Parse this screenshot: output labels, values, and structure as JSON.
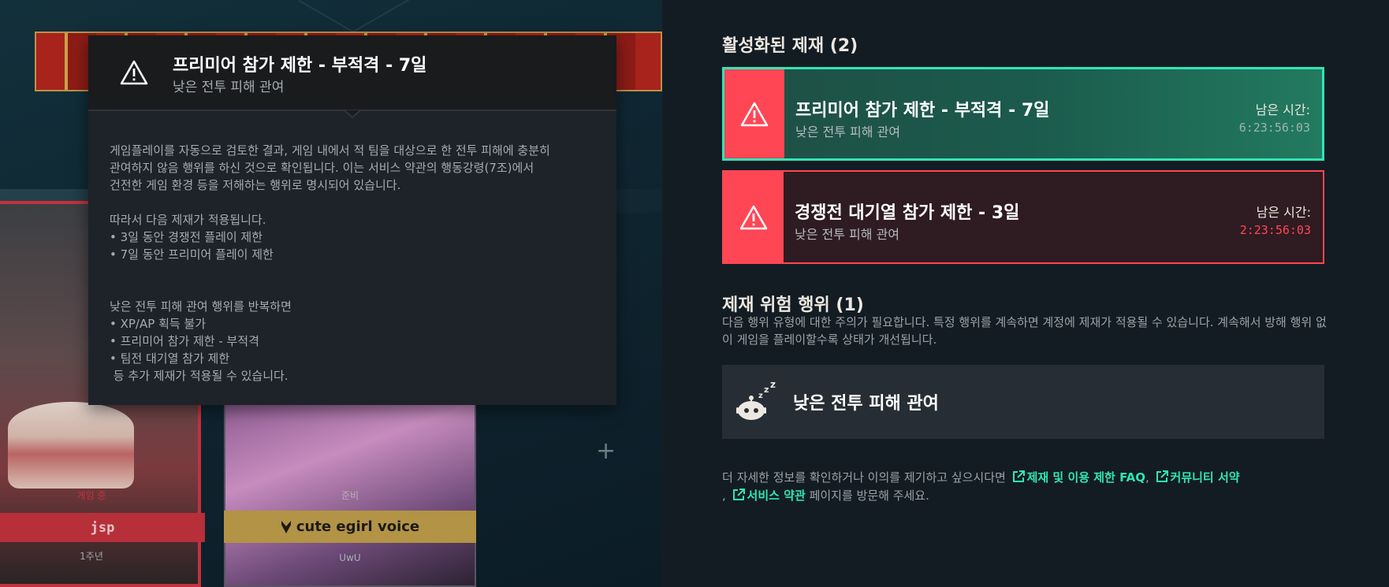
{
  "tooltip": {
    "title": "프리미어 참가 제한 - 부적격 - 7일",
    "subtitle": "낮은 전투 피해 관여",
    "body": {
      "p1": [
        "게임플레이를 자동으로 검토한 결과, 게임 내에서 적 팀을 대상으로 한 전투 피해에 충분히",
        "관여하지 않음 행위를 하신 것으로 확인됩니다. 이는 서비스 약관의 행동강령(7조)에서",
        "건전한 게임 환경 등을 저해하는 행위로 명시되어 있습니다."
      ],
      "p2": [
        "따라서 다음 제재가 적용됩니다.",
        "• 3일 동안 경쟁전 플레이 제한",
        "• 7일 동안 프리미어 플레이 제한"
      ],
      "p3": [
        "낮은 전투 피해 관여 행위를 반복하면",
        "• XP/AP 획득 불가",
        "• 프리미어 참가 제한 - 부적격",
        "• 팀전 대기열 참가 제한",
        " 등 추가 제재가 적용될 수 있습니다."
      ]
    }
  },
  "background": {
    "card_left": {
      "status": "게임 중",
      "name": "jsp",
      "title": "1주년"
    },
    "card_right": {
      "status": "준비",
      "name": "cute egirl voice",
      "title": "UwU"
    }
  },
  "panel": {
    "active_heading": "활성화된 제재 (2)",
    "penalties": [
      {
        "title": "프리미어 참가 제한 - 부적격 - 7일",
        "subtitle": "낮은 전투 피해 관여",
        "remain_label": "남은 시간:",
        "remain_time": "6:23:56:03"
      },
      {
        "title": "경쟁전 대기열 참가 제한 - 3일",
        "subtitle": "낮은 전투 피해 관여",
        "remain_label": "남은 시간:",
        "remain_time": "2:23:56:03"
      }
    ],
    "risk_heading": "제재 위험 행위 (1)",
    "risk_desc": "다음 행위 유형에 대한 주의가 필요합니다. 특정 행위를 계속하면 계정에 제재가 적용될 수 있습니다. 계속해서 방해 행위 없이 게임을 플레이할수록 상태가 개선됩니다.",
    "risk_items": [
      {
        "label": "낮은 전투 피해 관여",
        "icon": "sleeping-bot-icon"
      }
    ],
    "footer": {
      "prefix": "더 자세한 정보를 확인하거나 이의를 제기하고 싶으시다면",
      "link1": "제재 및 이용 제한 FAQ",
      "link2": "커뮤니티 서약",
      "link3": "서비스 약관",
      "suffix": "페이지를 방문해 주세요."
    }
  },
  "colors": {
    "accent_red": "#ff4655",
    "accent_teal": "#2ee6b5",
    "gold": "#b39345"
  }
}
